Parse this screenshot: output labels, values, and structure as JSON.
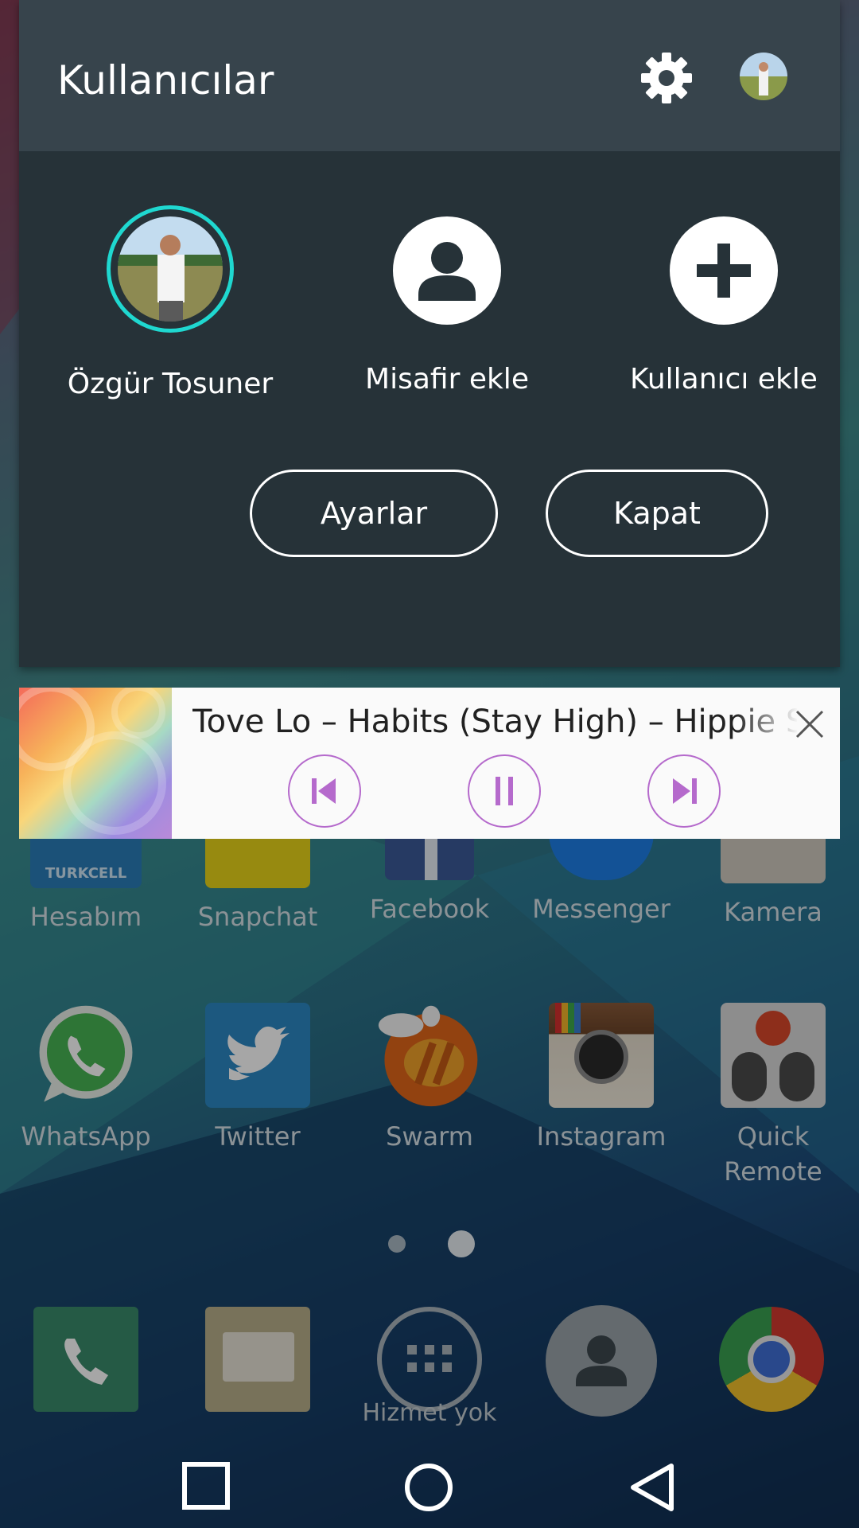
{
  "panel": {
    "title": "Kullanıcılar",
    "accent_color": "#1fd8d0",
    "users": [
      {
        "name": "Özgür Tosuner",
        "icon": "user-photo-avatar",
        "selected": true
      },
      {
        "name": "Misafir ekle",
        "icon": "person-icon"
      },
      {
        "name": "Kullanıcı ekle",
        "icon": "plus-icon"
      }
    ],
    "buttons": {
      "settings": "Ayarlar",
      "close": "Kapat"
    }
  },
  "media": {
    "track": "Tove Lo – Habits (Stay High) – Hippie Sabotage Remix",
    "controls": [
      "previous-icon",
      "pause-icon",
      "next-icon"
    ],
    "accent_color": "#b56acc"
  },
  "launcher": {
    "row1": [
      "Hesabım",
      "Snapchat",
      "Facebook",
      "Messenger",
      "Kamera"
    ],
    "row1_badge": "TURKCELL",
    "row2": [
      "WhatsApp",
      "Twitter",
      "Swarm",
      "Instagram",
      "Quick Remote"
    ],
    "dock_status": "Hizmet yok"
  },
  "navbar": [
    "recents-icon",
    "home-icon",
    "back-icon"
  ]
}
